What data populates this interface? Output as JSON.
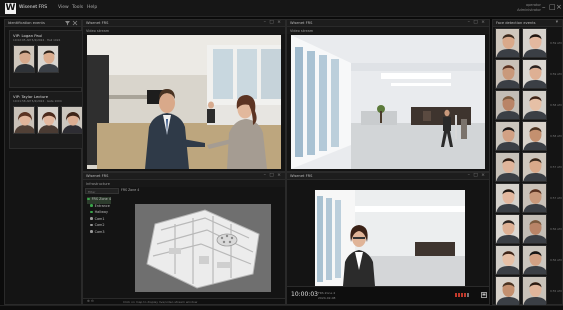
{
  "app": {
    "logo_letter": "W",
    "title": "Wisenet FRS",
    "menus": [
      "View",
      "Tools",
      "Help"
    ],
    "user_line1": "operator",
    "user_line2": "Administrator"
  },
  "window_controls": [
    "–",
    "□",
    "×"
  ],
  "panel_controls": "– □ ×",
  "identification": {
    "title": "Identification events",
    "cards": [
      {
        "name": "VIP: Logan Paul",
        "meta": "10:02:05 AM  5/4/2024   ·  Hall 1024"
      },
      {
        "name": "VIP: Taylor Lecture",
        "meta": "10:01:58 AM  5/4/2024   ·  Gate 1004"
      }
    ]
  },
  "video_top_left": {
    "title": "Wisenet FRS",
    "label": "Video stream"
  },
  "video_top_right": {
    "title": "Wisenet FRS",
    "label": "Video stream"
  },
  "infra": {
    "title": "Wisenet FRS",
    "sub": "Infrastructure",
    "filter_placeholder": "Filter",
    "map_tab": "FRS Zone 4",
    "tree": [
      {
        "label": "FRS Zone 4",
        "color": "#3aa54a"
      },
      {
        "label": "Entrance",
        "color": "#3aa54a"
      },
      {
        "label": "Hallway",
        "color": "#3aa54a"
      },
      {
        "label": "Cam1",
        "color": "#9a9a9a"
      },
      {
        "label": "Cam2",
        "color": "#9a9a9a"
      },
      {
        "label": "Cam3",
        "color": "#9a9a9a"
      }
    ],
    "hint": "Click on map to display live/video stream window"
  },
  "playback": {
    "title": "Wisenet FRS",
    "time": "10:00:03",
    "cam": "FRS Zone 4",
    "date": "2024-02-08"
  },
  "detection": {
    "title": "Face detection events",
    "times": [
      "9:59 AM",
      "9:59 AM",
      "9:58 AM",
      "9:58 AM",
      "9:57 AM",
      "9:57 AM",
      "9:56 AM",
      "9:56 AM",
      "9:55 AM"
    ]
  }
}
